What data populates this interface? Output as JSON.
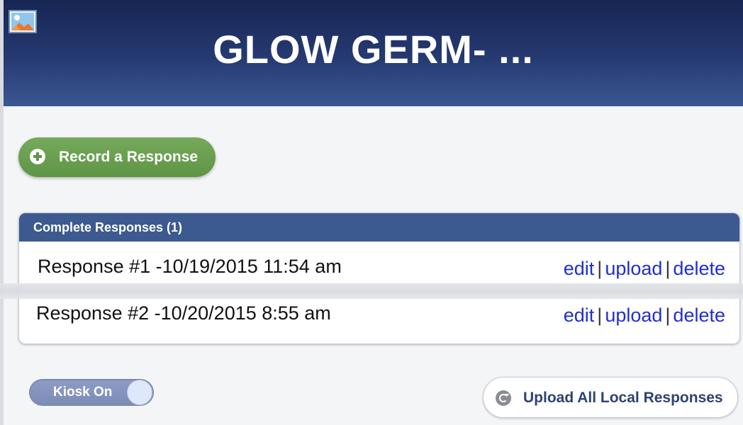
{
  "header": {
    "title": "GLOW GERM- ...",
    "icon": "image-icon"
  },
  "record_button": {
    "label": "Record a Response",
    "icon": "plus-circle-icon",
    "color": "#6a9f50"
  },
  "panel": {
    "heading": "Complete Responses (1)",
    "header_color": "#3c5a8f",
    "responses": [
      {
        "text": "Response #1 -10/19/2015  11:54 am",
        "actions": {
          "edit": "edit",
          "upload": "upload",
          "delete": "delete",
          "separator": "|"
        }
      },
      {
        "text": "Response #2 -10/20/2015  8:55 am",
        "actions": {
          "edit": "edit",
          "upload": "upload",
          "delete": "delete",
          "separator": "|"
        }
      }
    ]
  },
  "kiosk": {
    "label": "Kiosk On",
    "state": "on"
  },
  "upload_all": {
    "label": "Upload All Local Responses",
    "icon": "refresh-icon"
  },
  "colors": {
    "link": "#1f2fd1",
    "header_dark": "#172553",
    "header_light": "#3b5792"
  }
}
